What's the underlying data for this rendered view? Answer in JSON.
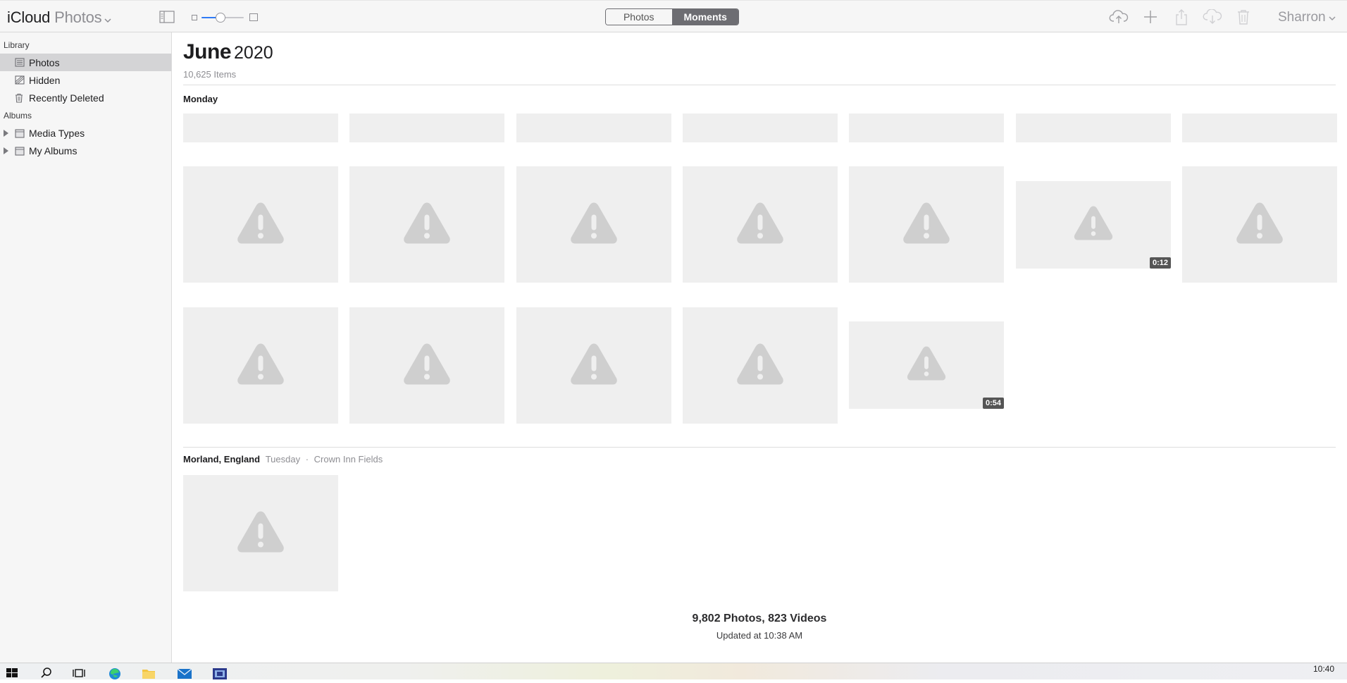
{
  "app": {
    "brand": "iCloud",
    "product": "Photos"
  },
  "toolbar": {
    "view_tabs": [
      {
        "label": "Photos",
        "selected": false
      },
      {
        "label": "Moments",
        "selected": true
      }
    ],
    "zoom_level": 0.45,
    "icons": [
      "upload-icon",
      "add-icon",
      "share-icon",
      "download-icon",
      "trash-icon"
    ],
    "user": "Sharron"
  },
  "sidebar": {
    "library_header": "Library",
    "library_items": [
      {
        "label": "Photos",
        "icon": "photos-icon",
        "selected": true
      },
      {
        "label": "Hidden",
        "icon": "hidden-icon",
        "selected": false
      },
      {
        "label": "Recently Deleted",
        "icon": "trash-icon",
        "selected": false
      }
    ],
    "albums_header": "Albums",
    "album_items": [
      {
        "label": "Media Types",
        "icon": "folder-icon"
      },
      {
        "label": "My Albums",
        "icon": "folder-icon"
      }
    ]
  },
  "main": {
    "month": "June",
    "year": "2020",
    "item_count": "10,625 Items",
    "moments": [
      {
        "day": "Monday",
        "rows": 3,
        "videos": [
          {
            "duration": "0:12"
          },
          {
            "duration": "0:54"
          }
        ]
      },
      {
        "place": "Morland, England",
        "day": "Tuesday",
        "separator": "·",
        "sublocation": "Crown Inn Fields"
      }
    ],
    "footer": {
      "totals": "9,802 Photos, 823 Videos",
      "updated": "Updated at 10:38 AM"
    }
  },
  "taskbar": {
    "apps": [
      "windows-start-icon",
      "search-icon",
      "task-view-icon",
      "edge-icon",
      "file-explorer-icon",
      "mail-icon",
      "app-icon"
    ],
    "time": "10:40"
  },
  "colors": {
    "accent": "#2f7bf5",
    "placeholder": "#efefef",
    "warning_glyph": "#cfcfcf",
    "selected_row": "#d4d4d6"
  }
}
